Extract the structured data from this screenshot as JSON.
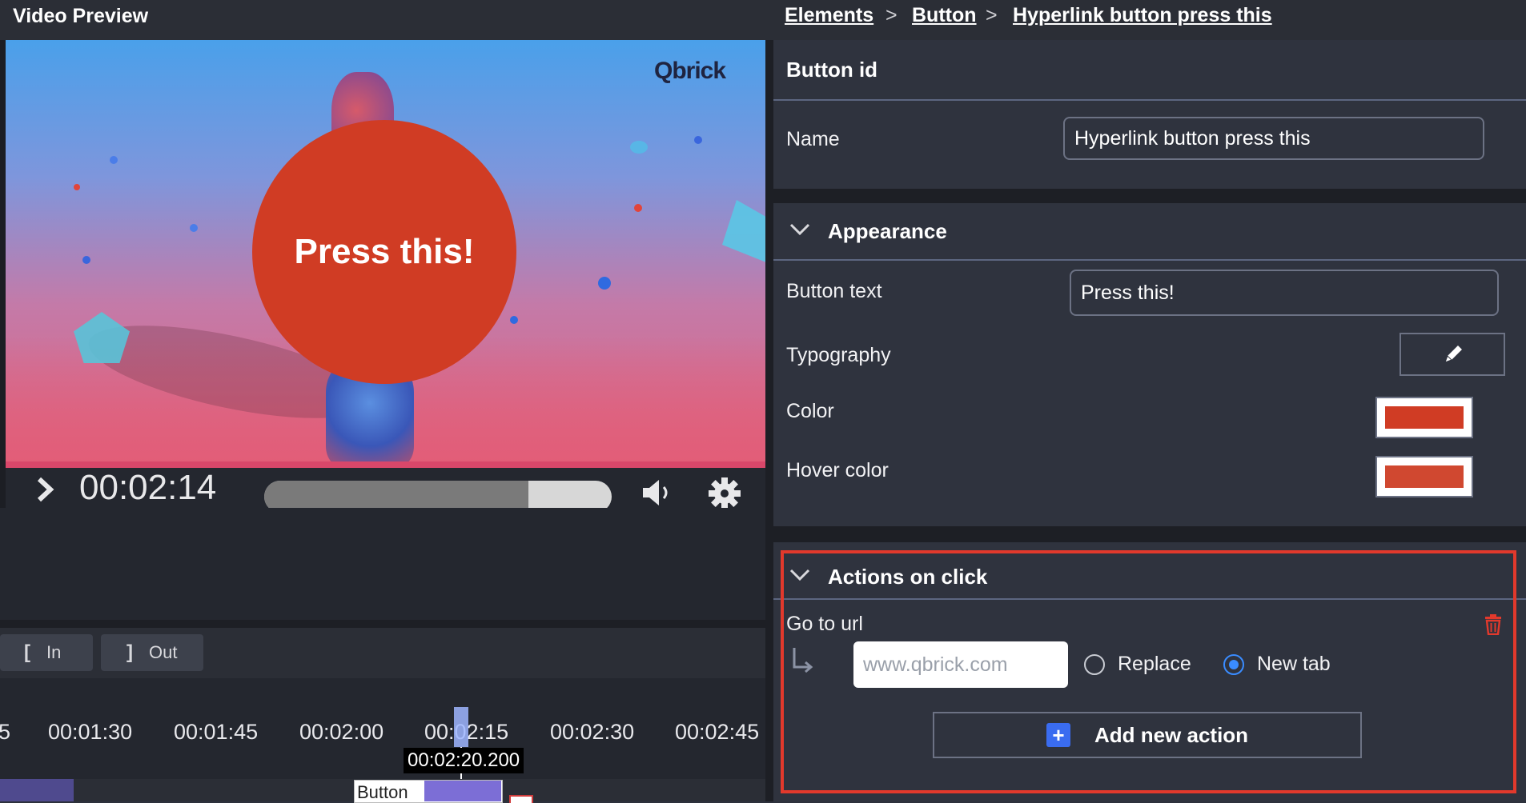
{
  "video_preview": {
    "title": "Video Preview",
    "logo_text": "Qbrick",
    "button_text": "Press this!",
    "button_color": "#d03c24",
    "current_time": "00:02:14",
    "progress_fraction": 0.76,
    "controls": {
      "play_icon": "play-icon",
      "volume_icon": "volume-icon",
      "settings_icon": "gear-icon"
    }
  },
  "inout": {
    "in_glyph": "[",
    "in_label": "In",
    "out_glyph": "]",
    "out_label": "Out"
  },
  "timeline": {
    "ticks": [
      "5",
      "00:01:30",
      "00:01:45",
      "00:02:00",
      "00:02:15",
      "00:02:30",
      "00:02:45"
    ],
    "playhead_time": "00:02:20.200",
    "clip_label": "Button"
  },
  "breadcrumb": {
    "items": [
      "Elements",
      "Button",
      "Hyperlink button press this"
    ],
    "separator": ">"
  },
  "button_id": {
    "section_title": "Button id",
    "name_label": "Name",
    "name_value": "Hyperlink button press this"
  },
  "appearance": {
    "section_title": "Appearance",
    "button_text_label": "Button text",
    "button_text_value": "Press this!",
    "typography_label": "Typography",
    "color_label": "Color",
    "color_value": "#d03c24",
    "hover_color_label": "Hover color",
    "hover_color_value": "#d04830"
  },
  "actions": {
    "section_title": "Actions on click",
    "action_label": "Go to url",
    "url_placeholder": "www.qbrick.com",
    "replace_label": "Replace",
    "new_tab_label": "New tab",
    "selected": "New tab",
    "add_label": "Add new action",
    "accent": "#3a8cff",
    "highlight_color": "#e2392c"
  }
}
